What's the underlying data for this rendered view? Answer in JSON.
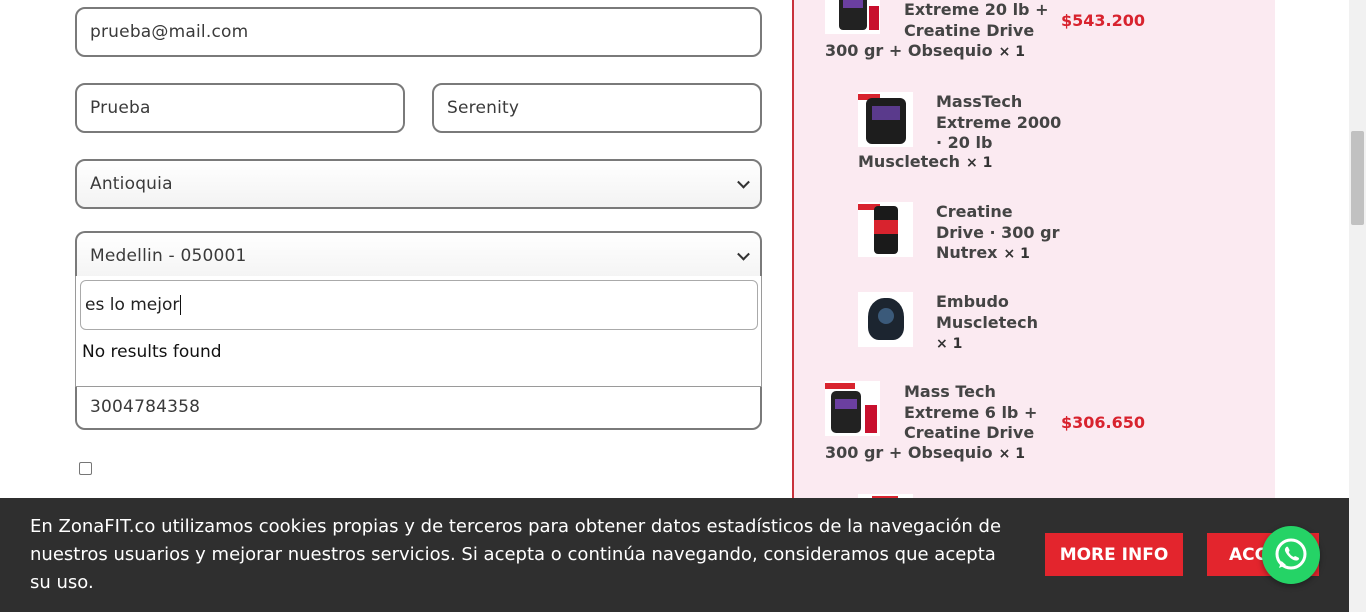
{
  "form": {
    "email": "prueba@mail.com",
    "first_name": "Prueba",
    "last_name": "Serenity",
    "department": "Antioquia",
    "city": "Medellin - 050001",
    "search_value": "es lo mejor",
    "no_results": "No results found",
    "phone": "3004784358"
  },
  "order": {
    "items": [
      {
        "name_lines": [
          "Extreme 20 lb +",
          "Creatine Drive"
        ],
        "name_tail": "300 gr + Obsequio",
        "qty": "× 1",
        "price": "$543.200"
      },
      {
        "name_lines": [
          "MassTech",
          "Extreme 2000",
          "· 20 lb"
        ],
        "name_tail": "Muscletech",
        "qty": "× 1"
      },
      {
        "name_lines": [
          "Creatine",
          "Drive · 300 gr"
        ],
        "name_tail": "Nutrex",
        "qty": "× 1"
      },
      {
        "name_lines": [
          "Embudo",
          "Muscletech"
        ],
        "name_tail": "",
        "qty": "× 1"
      },
      {
        "name_lines": [
          "Mass Tech",
          "Extreme 6 lb +",
          "Creatine Drive"
        ],
        "name_tail": "300 gr + Obsequio",
        "qty": "× 1",
        "price": "$306.650"
      }
    ]
  },
  "cookie": {
    "text": "En ZonaFIT.co utilizamos cookies propias y de terceros para obtener datos estadísticos de la navegación de nuestros usuarios y mejorar nuestros servicios. Si acepta o continúa navegando, consideramos que acepta su uso.",
    "more_info": "MORE INFO",
    "accept": "ACCEPT"
  },
  "colors": {
    "accent": "#e3252d",
    "panel_bg": "#fbeaf1",
    "whatsapp": "#25d366"
  }
}
